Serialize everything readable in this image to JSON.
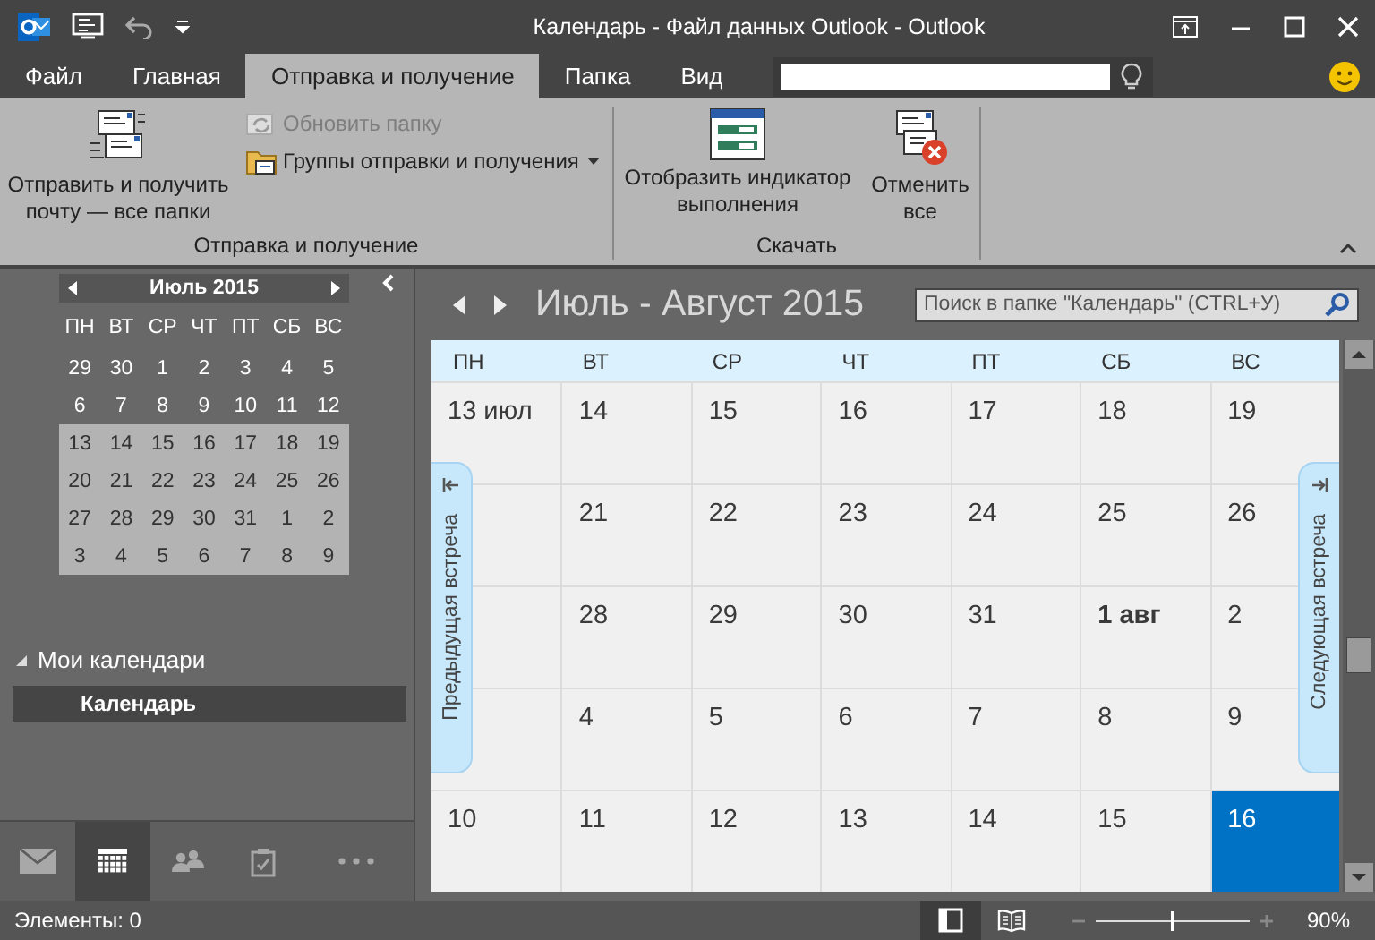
{
  "window": {
    "title": "Календарь - Файл данных Outlook - Outlook"
  },
  "ribbon_tabs": [
    {
      "label": "Файл",
      "selected": false
    },
    {
      "label": "Главная",
      "selected": false
    },
    {
      "label": "Отправка и получение",
      "selected": true
    },
    {
      "label": "Папка",
      "selected": false
    },
    {
      "label": "Вид",
      "selected": false
    }
  ],
  "ribbon_groups": [
    {
      "label": "Отправка и получение",
      "buttons": [
        {
          "kind": "large",
          "label": "Отправить и получить почту — все папки",
          "disabled": false,
          "dropdown": false
        },
        {
          "kind": "small",
          "label": "Обновить папку",
          "disabled": true,
          "dropdown": false
        },
        {
          "kind": "small",
          "label": "Группы отправки и получения",
          "disabled": false,
          "dropdown": true
        }
      ]
    },
    {
      "label": "Скачать",
      "buttons": [
        {
          "kind": "large",
          "label": "Отобразить индикатор выполнения",
          "disabled": false,
          "dropdown": false
        },
        {
          "kind": "large",
          "label": "Отменить все",
          "disabled": false,
          "dropdown": false
        }
      ]
    }
  ],
  "mini_calendar": {
    "month": "Июль 2015",
    "weekdays": [
      "ПН",
      "ВТ",
      "СР",
      "ЧТ",
      "ПТ",
      "СБ",
      "ВС"
    ],
    "weeks": [
      {
        "selected": false,
        "days": [
          "29",
          "30",
          "1",
          "2",
          "3",
          "4",
          "5"
        ]
      },
      {
        "selected": false,
        "days": [
          "6",
          "7",
          "8",
          "9",
          "10",
          "11",
          "12"
        ]
      },
      {
        "selected": true,
        "days": [
          "13",
          "14",
          "15",
          "16",
          "17",
          "18",
          "19"
        ]
      },
      {
        "selected": true,
        "days": [
          "20",
          "21",
          "22",
          "23",
          "24",
          "25",
          "26"
        ]
      },
      {
        "selected": true,
        "days": [
          "27",
          "28",
          "29",
          "30",
          "31",
          "1",
          "2"
        ]
      },
      {
        "selected": true,
        "days": [
          "3",
          "4",
          "5",
          "6",
          "7",
          "8",
          "9"
        ]
      }
    ]
  },
  "folders": {
    "group": {
      "label": "Мои календари",
      "expanded": true
    },
    "items": [
      {
        "label": "Календарь",
        "selected": true
      }
    ]
  },
  "nav_bar": [
    {
      "kind": "mail",
      "selected": false
    },
    {
      "kind": "calendar",
      "selected": true
    },
    {
      "kind": "people",
      "selected": false
    },
    {
      "kind": "tasks",
      "selected": false
    },
    {
      "kind": "more",
      "selected": false
    }
  ],
  "calendar": {
    "title": "Июль - Август 2015",
    "search": {
      "placeholder": "Поиск в папке \"Календарь\" (CTRL+У)"
    },
    "weekdays": [
      "ПН",
      "ВТ",
      "СР",
      "ЧТ",
      "ПТ",
      "СБ",
      "ВС"
    ],
    "weeks": [
      [
        {
          "label": "13 июл",
          "today": false,
          "month_start": false
        },
        {
          "label": "14",
          "today": false,
          "month_start": false
        },
        {
          "label": "15",
          "today": false,
          "month_start": false
        },
        {
          "label": "16",
          "today": false,
          "month_start": false
        },
        {
          "label": "17",
          "today": false,
          "month_start": false
        },
        {
          "label": "18",
          "today": false,
          "month_start": false
        },
        {
          "label": "19",
          "today": false,
          "month_start": false
        }
      ],
      [
        {
          "label": "21",
          "today": false,
          "month_start": false
        },
        {
          "label": "22",
          "today": false,
          "month_start": false
        },
        {
          "label": "23",
          "today": false,
          "month_start": false
        },
        {
          "label": "24",
          "today": false,
          "month_start": false
        },
        {
          "label": "25",
          "today": false,
          "month_start": false
        },
        {
          "label": "26",
          "today": false,
          "month_start": false
        }
      ],
      [
        {
          "label": "28",
          "today": false,
          "month_start": false
        },
        {
          "label": "29",
          "today": false,
          "month_start": false
        },
        {
          "label": "30",
          "today": false,
          "month_start": false
        },
        {
          "label": "31",
          "today": false,
          "month_start": false
        },
        {
          "label": "1 авг",
          "today": false,
          "month_start": true
        },
        {
          "label": "2",
          "today": false,
          "month_start": false
        }
      ],
      [
        {
          "label": "4",
          "today": false,
          "month_start": false
        },
        {
          "label": "5",
          "today": false,
          "month_start": false
        },
        {
          "label": "6",
          "today": false,
          "month_start": false
        },
        {
          "label": "7",
          "today": false,
          "month_start": false
        },
        {
          "label": "8",
          "today": false,
          "month_start": false
        },
        {
          "label": "9",
          "today": false,
          "month_start": false
        }
      ],
      [
        {
          "label": "10",
          "today": false,
          "month_start": false
        },
        {
          "label": "11",
          "today": false,
          "month_start": false
        },
        {
          "label": "12",
          "today": false,
          "month_start": false
        },
        {
          "label": "13",
          "today": false,
          "month_start": false
        },
        {
          "label": "14",
          "today": false,
          "month_start": false
        },
        {
          "label": "15",
          "today": false,
          "month_start": false
        },
        {
          "label": "16",
          "today": true,
          "month_start": false
        }
      ]
    ],
    "prev_tab": "Предыдущая встреча",
    "next_tab": "Следующая встреча"
  },
  "status_bar": {
    "items_count": "Элементы: 0",
    "views": [
      {
        "kind": "normal",
        "selected": true
      },
      {
        "kind": "reading",
        "selected": false
      }
    ],
    "zoom": {
      "level": 0.5,
      "reading": "90%"
    }
  }
}
